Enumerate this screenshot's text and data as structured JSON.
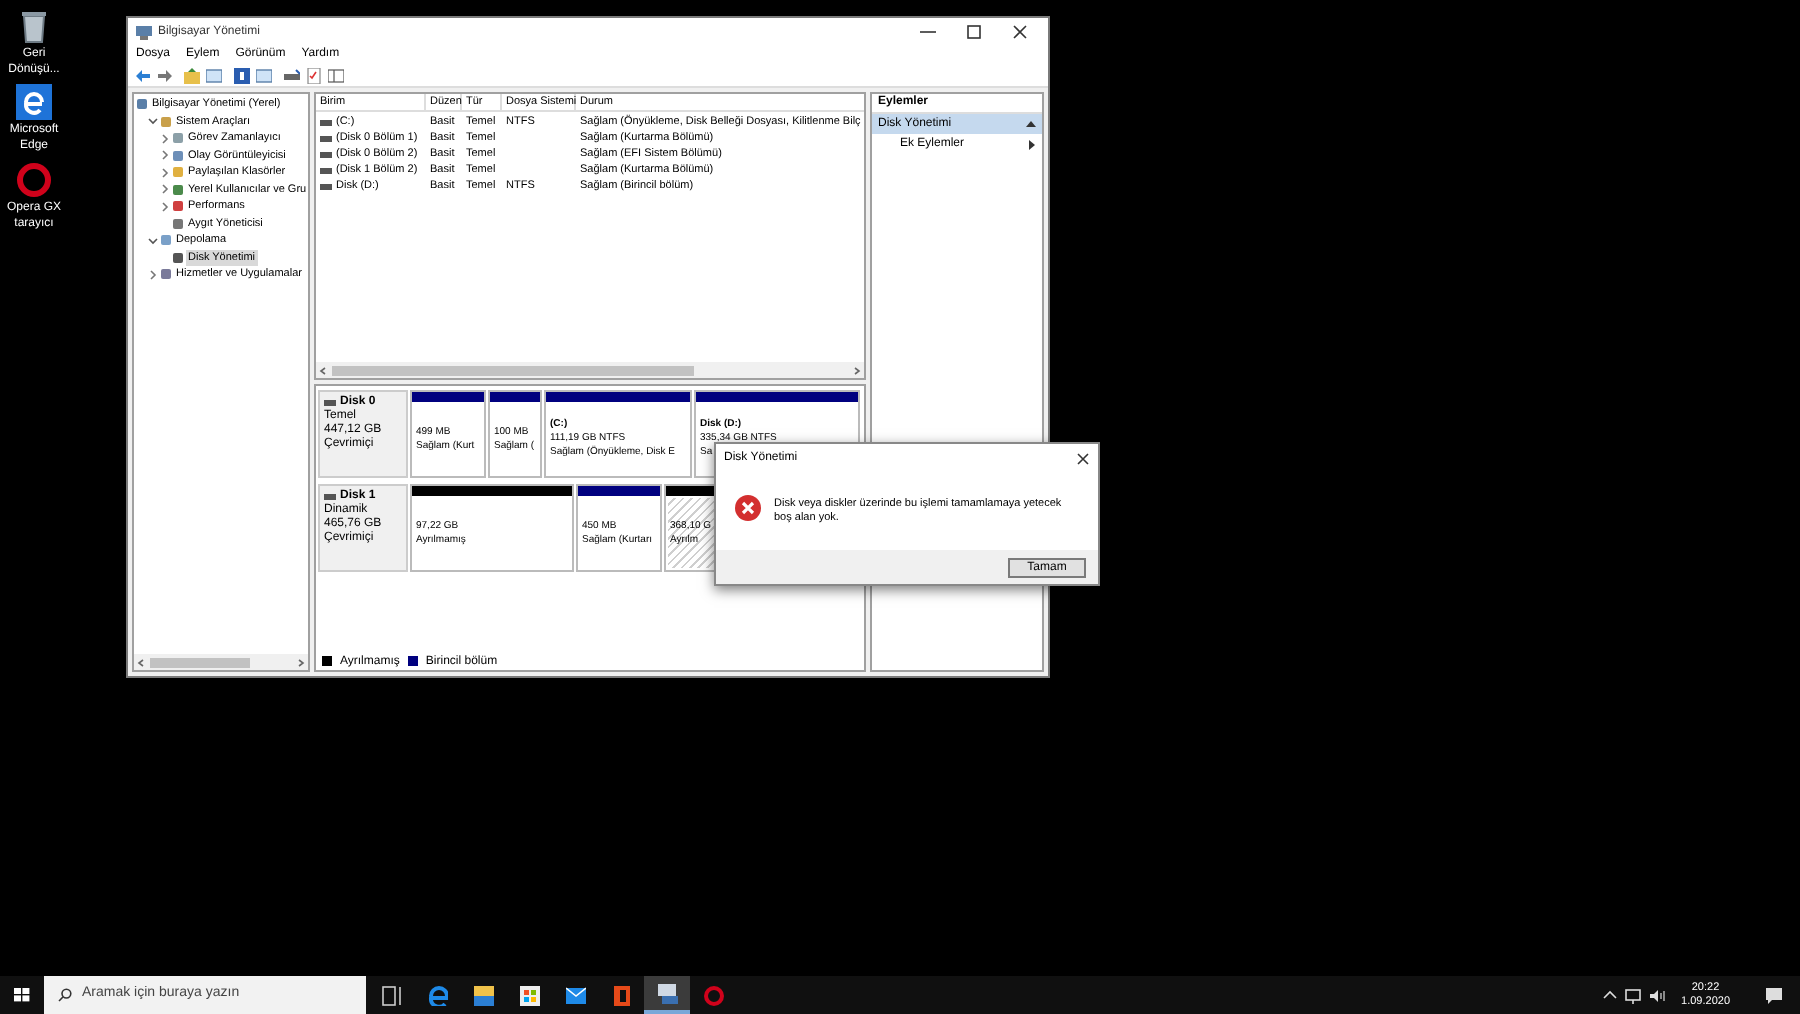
{
  "desktop_icons": [
    {
      "label": "Geri Dönüşü..."
    },
    {
      "label": "Microsoft Edge"
    },
    {
      "label": "Opera GX tarayıcı"
    }
  ],
  "window": {
    "title": "Bilgisayar Yönetimi",
    "menu": [
      "Dosya",
      "Eylem",
      "Görünüm",
      "Yardım"
    ]
  },
  "tree": [
    {
      "label": "Bilgisayar Yönetimi (Yerel)",
      "selected": false,
      "children": [
        {
          "label": "Sistem Araçları",
          "expanded": true,
          "selected": false,
          "children": [
            {
              "label": "Görev Zamanlayıcı",
              "expanded": false,
              "selected": false
            },
            {
              "label": "Olay Görüntüleyicisi",
              "expanded": false,
              "selected": false
            },
            {
              "label": "Paylaşılan Klasörler",
              "expanded": false,
              "selected": false
            },
            {
              "label": "Yerel Kullanıcılar ve Gru",
              "expanded": false,
              "selected": false
            },
            {
              "label": "Performans",
              "expanded": false,
              "selected": false
            },
            {
              "label": "Aygıt Yöneticisi",
              "selected": false
            }
          ]
        },
        {
          "label": "Depolama",
          "expanded": true,
          "selected": false,
          "children": [
            {
              "label": "Disk Yönetimi",
              "selected": true
            }
          ]
        },
        {
          "label": "Hizmetler ve Uygulamalar",
          "expanded": false,
          "selected": false
        }
      ]
    }
  ],
  "volume_table": {
    "columns": [
      "Birim",
      "Düzen",
      "Tür",
      "Dosya Sistemi",
      "Durum"
    ],
    "rows": [
      [
        "(C:)",
        "Basit",
        "Temel",
        "NTFS",
        "Sağlam (Önyükleme, Disk Belleği Dosyası, Kilitlenme Bilç"
      ],
      [
        "(Disk 0 Bölüm 1)",
        "Basit",
        "Temel",
        "",
        "Sağlam (Kurtarma Bölümü)"
      ],
      [
        "(Disk 0 Bölüm 2)",
        "Basit",
        "Temel",
        "",
        "Sağlam (EFI Sistem Bölümü)"
      ],
      [
        "(Disk 1 Bölüm 2)",
        "Basit",
        "Temel",
        "",
        "Sağlam (Kurtarma Bölümü)"
      ],
      [
        "Disk (D:)",
        "Basit",
        "Temel",
        "NTFS",
        "Sağlam (Birincil bölüm)"
      ]
    ]
  },
  "disks": [
    {
      "name": "Disk 0",
      "type": "Temel",
      "size": "447,12 GB",
      "status": "Çevrimiçi",
      "partitions": [
        {
          "kind": "primary",
          "selected": false,
          "lines": [
            "499 MB",
            "Sağlam (Kurt"
          ]
        },
        {
          "kind": "primary",
          "selected": false,
          "lines": [
            "100 MB",
            "Sağlam ("
          ]
        },
        {
          "kind": "primary",
          "selected": false,
          "title": "(C:)",
          "lines": [
            "111,19 GB NTFS",
            "Sağlam (Önyükleme, Disk E"
          ]
        },
        {
          "kind": "primary",
          "selected": false,
          "title": "Disk  (D:)",
          "lines": [
            "335,34 GB NTFS",
            "Sa"
          ]
        }
      ]
    },
    {
      "name": "Disk 1",
      "type": "Dinamik",
      "size": "465,76 GB",
      "status": "Çevrimiçi",
      "partitions": [
        {
          "kind": "unallocated",
          "selected": false,
          "lines": [
            "97,22 GB",
            "Ayrılmamış"
          ]
        },
        {
          "kind": "primary",
          "selected": false,
          "lines": [
            "450 MB",
            "Sağlam (Kurtarı"
          ]
        },
        {
          "kind": "unallocated",
          "selected": true,
          "lines": [
            "368,10 G",
            "Ayrılm"
          ]
        }
      ]
    }
  ],
  "legend": [
    {
      "label": "Ayrılmamış",
      "color": "#000000"
    },
    {
      "label": "Birincil bölüm",
      "color": "#00007f"
    }
  ],
  "actions": {
    "header": "Eylemler",
    "items": [
      {
        "label": "Disk Yönetimi",
        "kind": "section",
        "selected": true
      },
      {
        "label": "Ek Eylemler",
        "kind": "submenu",
        "selected": false
      }
    ]
  },
  "dialog": {
    "title": "Disk Yönetimi",
    "message": "Disk veya diskler üzerinde bu işlemi tamamlamaya yetecek boş alan yok.",
    "button": "Tamam"
  },
  "taskbar": {
    "search_placeholder": "Aramak için buraya yazın",
    "apps": [
      {
        "selected": false
      },
      {
        "selected": false
      },
      {
        "selected": false
      },
      {
        "selected": false
      },
      {
        "selected": false
      },
      {
        "selected": false
      },
      {
        "selected": true
      },
      {
        "selected": false
      }
    ],
    "time": "20:22",
    "date": "1.09.2020"
  }
}
